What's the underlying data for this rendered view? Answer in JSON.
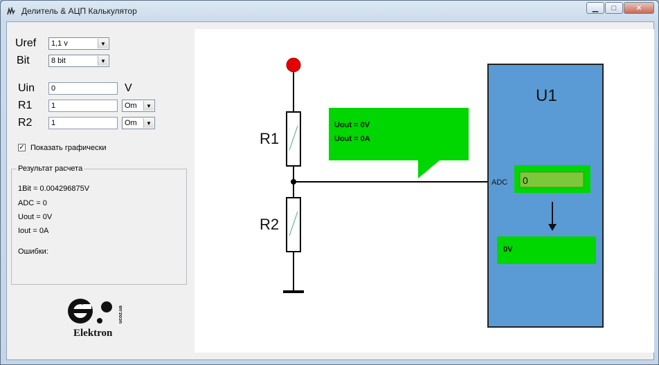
{
  "window": {
    "title": "Делитель & АЦП Калькулятор",
    "min": "▁",
    "max": "□",
    "close": "✕"
  },
  "form": {
    "uref_label": "Uref",
    "uref_value": "1,1 v",
    "bit_label": "Bit",
    "bit_value": "8 bit",
    "uin_label": "Uin",
    "uin_value": "0",
    "uin_unit": "V",
    "r1_label": "R1",
    "r1_value": "1",
    "r1_unit": "Om",
    "r2_label": "R2",
    "r2_value": "1",
    "r2_unit": "Om",
    "show_graph_label": "Показать графически",
    "show_graph_checked": true
  },
  "results": {
    "title": "Результат расчета",
    "bit": "1Bit = 0.004296875V",
    "adc": "ADC = 0",
    "uout": "Uout = 0V",
    "iout": "Iout = 0A",
    "errors": "Ошибки:"
  },
  "logo": {
    "name": "Elektron",
    "site": "ucoz.ua"
  },
  "diagram": {
    "r1_label": "R1",
    "r2_label": "R2",
    "bubble_uout": "Uout = 0V",
    "bubble_iout": "Uout = 0A",
    "u1_label": "U1",
    "adc_label": "ADC",
    "adc_value": "0",
    "output_value": "0V"
  },
  "colors": {
    "chip": "#5b9bd5",
    "green": "#00d600",
    "node_red": "#e60000"
  }
}
